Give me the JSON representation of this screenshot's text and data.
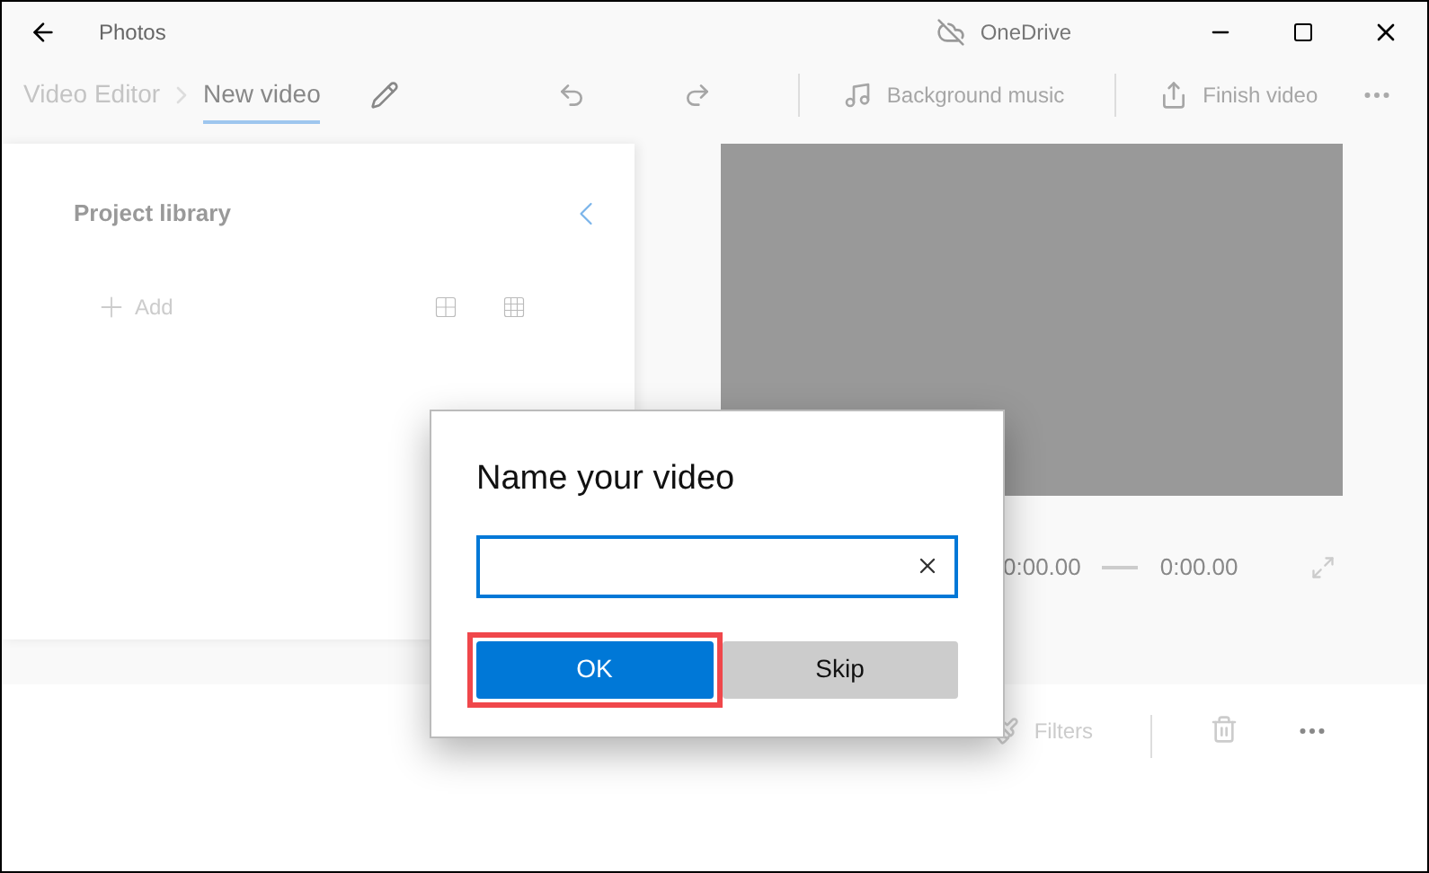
{
  "window": {
    "title": "Photos",
    "cloud_label": "OneDrive"
  },
  "breadcrumb": [
    {
      "label": "Video Editor",
      "selected": false
    },
    {
      "label": "New video",
      "selected": true
    }
  ],
  "toolbar": {
    "background_music": "Background music",
    "finish_video": "Finish video",
    "disabled": true
  },
  "project_library": {
    "title": "Project library",
    "add": "Add"
  },
  "preview": {
    "current_time": "0:00.00",
    "total_time": "0:00.00"
  },
  "storyboard": {
    "filters": "Filters"
  },
  "dialog": {
    "title": "Name your video",
    "buttons": [
      {
        "label": "OK",
        "kind": "primary",
        "highlighted": true
      },
      {
        "label": "Skip",
        "kind": "secondary",
        "highlighted": false
      }
    ]
  }
}
